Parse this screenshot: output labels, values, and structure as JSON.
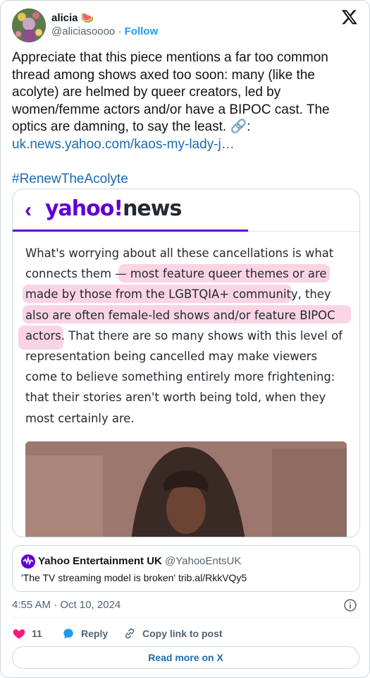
{
  "author": {
    "name": "alicia",
    "name_emoji": "🍉",
    "handle": "@aliciasoooo",
    "separator": "·",
    "follow_label": "Follow"
  },
  "tweet": {
    "text": "Appreciate that this piece mentions a far too common thread among shows axed too soon: many (like the acolyte) are helmed by queer creators, led by women/femme actors and/or have a BIPOC cast. The optics are damning, to say the least. 🔗:",
    "link": "uk.news.yahoo.com/kaos-my-lady-j…",
    "hashtag": "#RenewTheAcolyte"
  },
  "media": {
    "back_glyph": "‹",
    "logo_yahoo": "yahoo!",
    "logo_news": "news",
    "article_text": "What's worrying about all these cancellations is what connects them — most feature queer themes or are made by those from the LGBTQIA+ community, they also are often female-led shows and/or feature BIPOC actors. That there are so many shows with this level of representation being cancelled may make viewers come to believe something entirely more frightening: that their stories aren't worth being told, when they most certainly are."
  },
  "quote": {
    "name": "Yahoo Entertainment UK",
    "handle": "@YahooEntsUK",
    "text": "'The TV streaming model is broken' trib.al/RkkVQy5"
  },
  "meta": {
    "timestamp": "4:55 AM · Oct 10, 2024"
  },
  "actions": {
    "likes": "11",
    "reply_label": "Reply",
    "copy_label": "Copy link to post"
  },
  "footer": {
    "read_more": "Read more on X"
  },
  "colors": {
    "accent_blue": "#1d9bf0",
    "link_blue": "#1b6bb0",
    "yahoo_purple": "#6001d2",
    "like_pink": "#f91880",
    "highlight_pink": "#f078aa"
  },
  "icons": [
    "x-logo-icon",
    "link-icon",
    "heart-icon",
    "reply-bubble-icon",
    "copy-link-icon",
    "info-icon",
    "yahoo-logo-icon"
  ]
}
